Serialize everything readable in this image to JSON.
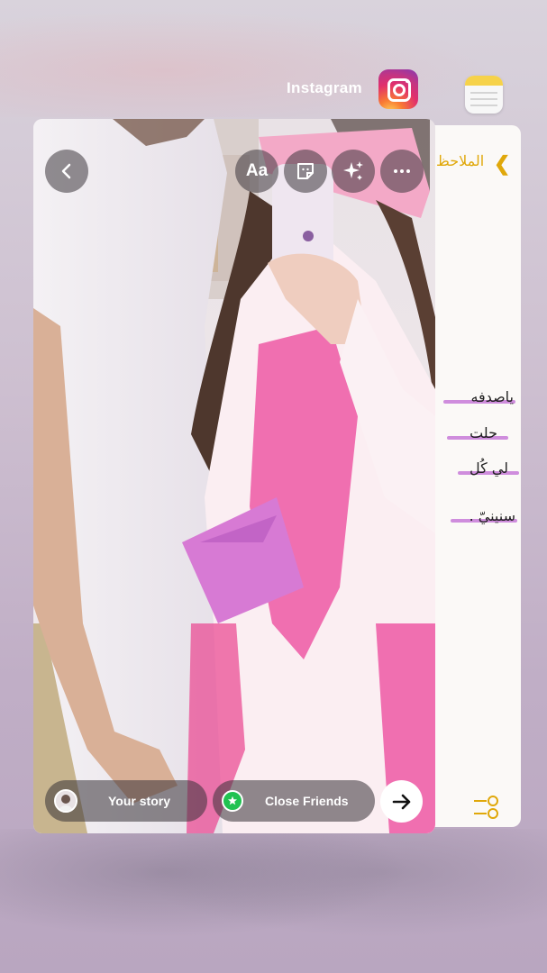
{
  "switcher": {
    "app_name": "Instagram",
    "app_icon": "instagram-icon",
    "next_app_icon": "notes-icon"
  },
  "story_editor": {
    "top_buttons": [
      "back-icon",
      "text-icon",
      "sticker-icon",
      "effects-icon",
      "more-icon"
    ],
    "text_tool_label": "Aa",
    "share_options": {
      "your_story": "Your story",
      "close_friends": "Close Friends"
    },
    "send_icon": "arrow-right-icon"
  },
  "notes": {
    "back_label": "الملاحظ",
    "lines": [
      "ياصدفه",
      "حلت",
      "لي كُل",
      "سنينيّ ."
    ],
    "highlight_color": "#c77ad8",
    "accent_color": "#e0a80b"
  }
}
